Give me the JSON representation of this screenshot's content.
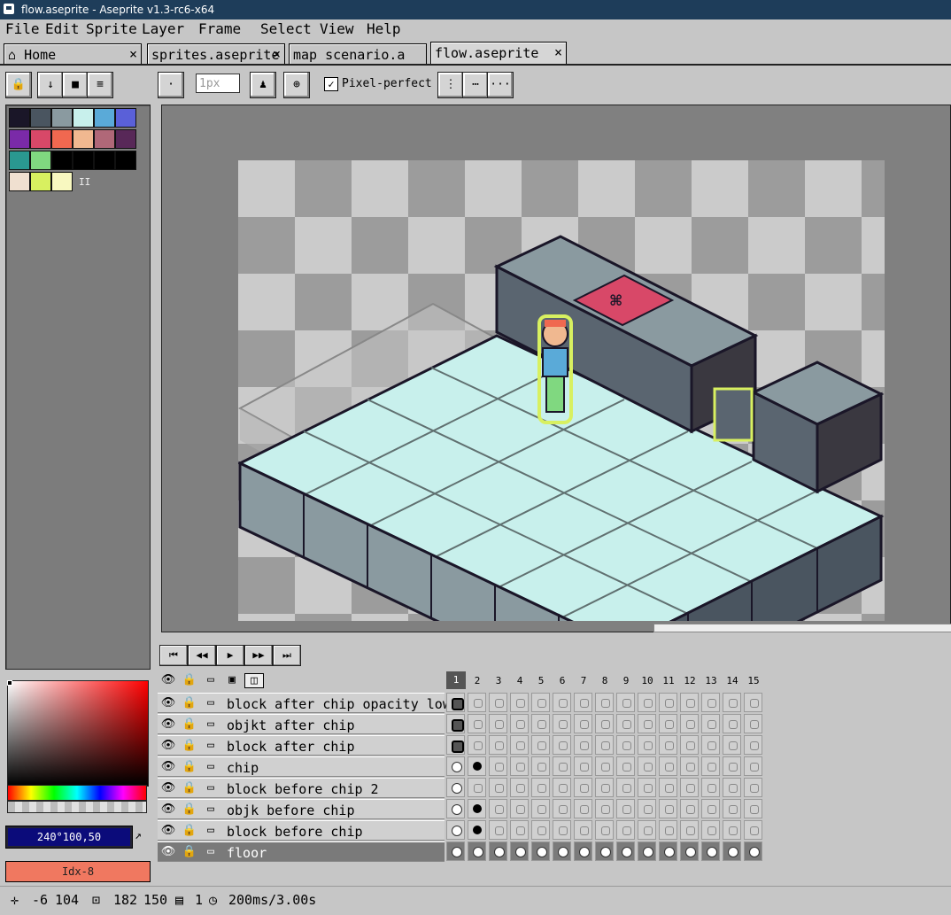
{
  "window": {
    "title": "flow.aseprite - Aseprite v1.3-rc6-x64"
  },
  "menu": [
    "File",
    "Edit",
    "Sprite",
    "Layer",
    "Frame",
    "Select",
    "View",
    "Help"
  ],
  "tabs": [
    {
      "label": "Home",
      "icon": "home-icon"
    },
    {
      "label": "sprites.aseprite"
    },
    {
      "label": "map scenario.a"
    },
    {
      "label": "flow.aseprite",
      "active": true
    }
  ],
  "tab_close": "×",
  "toolbar": {
    "brush_size_placeholder": "1px",
    "pixel_perfect_label": "Pixel-perfect",
    "pixel_perfect_checked": true,
    "more_label": "···"
  },
  "palette": {
    "colors": [
      "#1a1628",
      "#4a5560",
      "#8a9aa0",
      "#c8f0ec",
      "#5aaad8",
      "#5a60d8",
      "#7a2aa8",
      "#d84868",
      "#f06850",
      "#f0b890",
      "#b06878",
      "#582858",
      "#2a9890",
      "#80d880",
      "#000000",
      "#000000",
      "#000000",
      "#000000",
      "#f0e0d0",
      "#d8f060",
      "#f8f8c0"
    ],
    "marker": "II"
  },
  "color": {
    "hsv_text": "240°100,50",
    "index_text": "Idx-8",
    "accent": "#f07860"
  },
  "playback": [
    "⏮",
    "◀◀",
    "▶",
    "▶▶",
    "⏭"
  ],
  "timeline": {
    "frames": [
      "1",
      "2",
      "3",
      "4",
      "5",
      "6",
      "7",
      "8",
      "9",
      "10",
      "11",
      "12",
      "13",
      "14",
      "15"
    ],
    "layers": [
      {
        "name": "block after chip opacity low",
        "cels": "c"
      },
      {
        "name": "objkt after chip",
        "cels": "c"
      },
      {
        "name": "block after chip",
        "cels": "c"
      },
      {
        "name": "chip",
        "cels": "kk"
      },
      {
        "name": "block before chip 2",
        "cels": "k"
      },
      {
        "name": "objk before chip",
        "cels": "kk"
      },
      {
        "name": "block before chip",
        "cels": "kk"
      },
      {
        "name": "floor",
        "cels": "all",
        "selected": true
      }
    ]
  },
  "status": {
    "pos_x": "-6",
    "pos_y": "104",
    "size_w": "182",
    "size_h": "150",
    "frame": "1",
    "duration": "200ms/3.00s"
  }
}
